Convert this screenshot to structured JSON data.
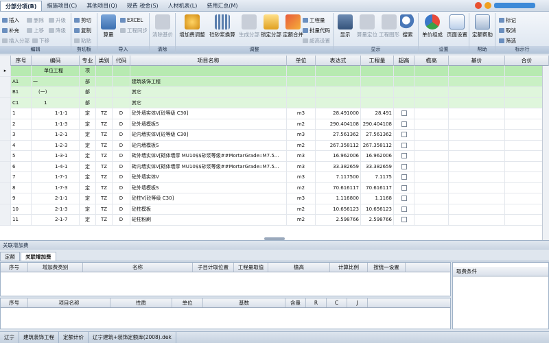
{
  "tabs": [
    "分部分项(B)",
    "措施项目(C)",
    "其他项目(Q)",
    "规费 税金(S)",
    "人材机表(L)",
    "费用汇总(M)"
  ],
  "ribbon": {
    "edit": {
      "label": "编辑",
      "insert": "插入",
      "delete": "删除",
      "upgrade": "升级",
      "append": "补充",
      "moveup": "上移",
      "downgrade": "降级",
      "insert_sub": "插入分部",
      "movedown": "下移"
    },
    "clipboard": {
      "label": "剪切板",
      "cut": "剪切",
      "copy": "复制",
      "paste": "粘贴"
    },
    "import": {
      "label": "导入",
      "calc": "算量",
      "excel": "EXCEL",
      "sync": "工程同步"
    },
    "clear": {
      "label": "清除",
      "clear_basis": "清除基价"
    },
    "adjust": {
      "label": "调整",
      "add_fee": "增加费调整",
      "mortar": "砼砂浆换算",
      "gen_sub": "生成分部",
      "lock_sub": "锁定分部",
      "quota_merge": "定额合并",
      "project_quantity": "工程量",
      "batch_code": "批量代码",
      "over_height": "超高设置"
    },
    "display": {
      "label": "显示",
      "show": "显示",
      "calc_lock": "算量定位",
      "project_graph": "工程图形",
      "search": "搜索"
    },
    "settings": {
      "label": "设置",
      "unit_group": "单价组成",
      "page_setup": "页面设置"
    },
    "help": {
      "label": "帮助",
      "quota_help": "定额帮助"
    },
    "marks": {
      "label": "标示行",
      "mark": "标记",
      "cancel": "取消",
      "filter": "筛选"
    }
  },
  "grid": {
    "headers": [
      "序号",
      "编码",
      "专业",
      "类别",
      "代码",
      "项目名称",
      "单位",
      "表达式",
      "工程量",
      "超高",
      "檐高",
      "基价",
      "合价"
    ],
    "rows": [
      {
        "no": "",
        "code": "单位工程",
        "spec": "项",
        "type": "",
        "dm": "",
        "name": "",
        "unit": "",
        "expr": "",
        "qty": "",
        "kind": "sel"
      },
      {
        "no": "A1",
        "code": "一",
        "spec": "部",
        "type": "",
        "dm": "",
        "name": "建筑装饰工程",
        "unit": "",
        "expr": "",
        "qty": "",
        "kind": "g"
      },
      {
        "no": "B1",
        "code": "(一)",
        "spec": "部",
        "type": "",
        "dm": "",
        "name": "其它",
        "unit": "",
        "expr": "",
        "qty": "",
        "kind": "g"
      },
      {
        "no": "C1",
        "code": "1",
        "spec": "部",
        "type": "",
        "dm": "",
        "name": "其它",
        "unit": "",
        "expr": "",
        "qty": "",
        "kind": "g"
      },
      {
        "no": "1",
        "code": "1-1-1",
        "spec": "定",
        "type": "TZ",
        "dm": "D",
        "name": "砼外墙实体V[砼等级 C30]",
        "unit": "m3",
        "expr": "28.491000",
        "qty": "28.491",
        "kind": ""
      },
      {
        "no": "2",
        "code": "1-1-3",
        "spec": "定",
        "type": "TZ",
        "dm": "D",
        "name": "砼外墙模板S",
        "unit": "m2",
        "expr": "290.404108",
        "qty": "290.404108",
        "kind": ""
      },
      {
        "no": "3",
        "code": "1-2-1",
        "spec": "定",
        "type": "TZ",
        "dm": "D",
        "name": "砼内墙实体V[砼等级 C30]",
        "unit": "m3",
        "expr": "27.561362",
        "qty": "27.561362",
        "kind": ""
      },
      {
        "no": "4",
        "code": "1-2-3",
        "spec": "定",
        "type": "TZ",
        "dm": "D",
        "name": "砼内墙模板S",
        "unit": "m2",
        "expr": "267.358112",
        "qty": "267.358112",
        "kind": ""
      },
      {
        "no": "5",
        "code": "1-3-1",
        "spec": "定",
        "type": "TZ",
        "dm": "D",
        "name": "砖外墙实体V[砌体墙厚 MU10$$砂浆等级##MortarGrade::M7.5...",
        "unit": "m3",
        "expr": "16.962006",
        "qty": "16.962006",
        "kind": ""
      },
      {
        "no": "6",
        "code": "1-4-1",
        "spec": "定",
        "type": "TZ",
        "dm": "D",
        "name": "砖内墙实体V[砌体墙厚 MU10$$砂浆等级##MortarGrade::M7.5...",
        "unit": "m3",
        "expr": "33.382659",
        "qty": "33.382659",
        "kind": ""
      },
      {
        "no": "7",
        "code": "1-7-1",
        "spec": "定",
        "type": "TZ",
        "dm": "D",
        "name": "砼外墙实体V",
        "unit": "m3",
        "expr": "7.117500",
        "qty": "7.1175",
        "kind": ""
      },
      {
        "no": "8",
        "code": "1-7-3",
        "spec": "定",
        "type": "TZ",
        "dm": "D",
        "name": "砼外墙模板S",
        "unit": "m2",
        "expr": "70.616117",
        "qty": "70.616117",
        "kind": ""
      },
      {
        "no": "9",
        "code": "2-1-1",
        "spec": "定",
        "type": "TZ",
        "dm": "D",
        "name": "砼柱V[砼等级 C30]",
        "unit": "m3",
        "expr": "1.116800",
        "qty": "1.1168",
        "kind": ""
      },
      {
        "no": "10",
        "code": "2-1-3",
        "spec": "定",
        "type": "TZ",
        "dm": "D",
        "name": "砼柱模板",
        "unit": "m2",
        "expr": "10.656123",
        "qty": "10.656123",
        "kind": ""
      },
      {
        "no": "11",
        "code": "2-1-7",
        "spec": "定",
        "type": "TZ",
        "dm": "D",
        "name": "砼柱粉刷",
        "unit": "m2",
        "expr": "2.598766",
        "qty": "2.598766",
        "kind": ""
      }
    ]
  },
  "split_label": "关联增加费",
  "bottom_tabs": [
    "定额",
    "关联增加费"
  ],
  "pane1_headers": [
    "序号",
    "增加费类别",
    "名称",
    "子目计取位置",
    "工程量取值",
    "檐高",
    "计算比例",
    "按统一设置"
  ],
  "pane2_headers": [
    "序号",
    "项目名称",
    "性质",
    "单位",
    "基数",
    "含量",
    "R",
    "C",
    "J"
  ],
  "side_title": "取费条件",
  "status": [
    "辽宁",
    "建筑装饰工程",
    "定额计价",
    "辽宁建筑+装饰定额库(2008).dek"
  ]
}
